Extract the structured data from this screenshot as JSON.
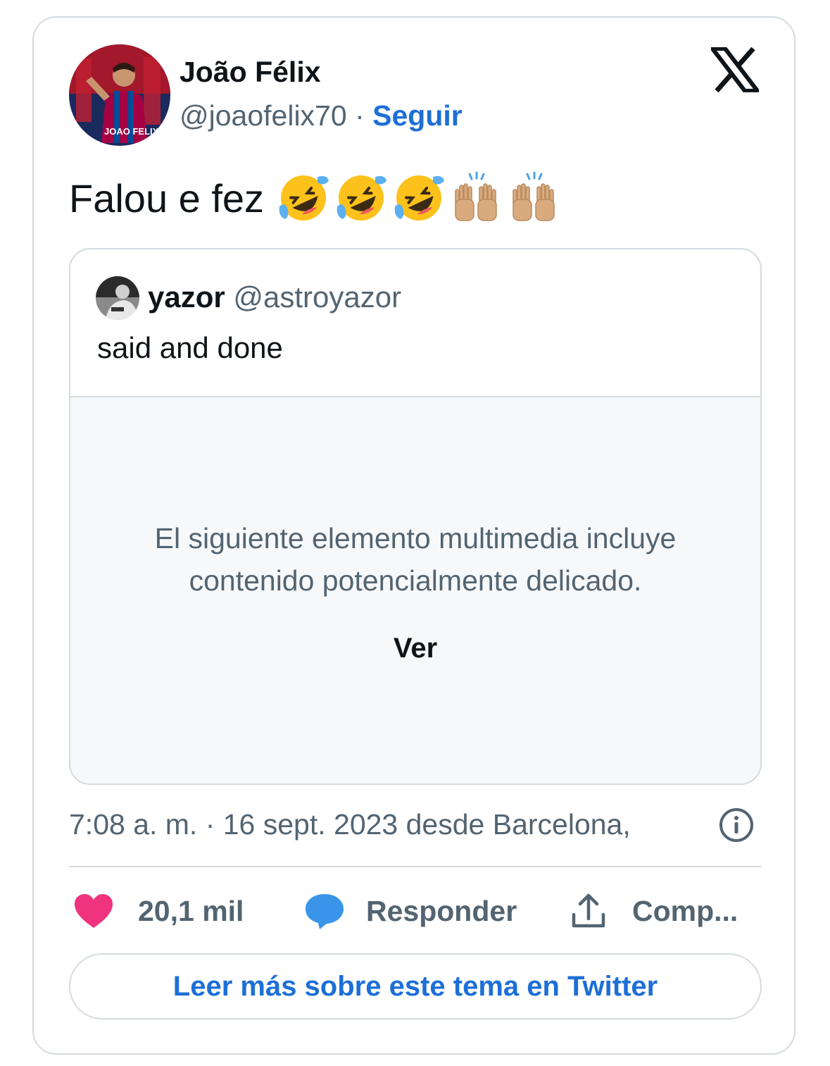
{
  "author": {
    "name": "João Félix",
    "handle": "@joaofelix70",
    "separator": "·",
    "follow_label": "Seguir"
  },
  "tweet": {
    "text": "Falou e fez",
    "emojis": [
      "rolling-on-floor-laughing",
      "rolling-on-floor-laughing",
      "rolling-on-floor-laughing",
      "raising-hands",
      "raising-hands"
    ]
  },
  "quote": {
    "name": "yazor",
    "handle": "@astroyazor",
    "text": "said and done",
    "media_warning_line1": "El siguiente elemento multimedia incluye",
    "media_warning_line2": "contenido potencialmente delicado.",
    "view_label": "Ver"
  },
  "timestamp": "7:08 a. m. · 16 sept. 2023 desde Barcelona,",
  "actions": {
    "likes": "20,1 mil",
    "reply_label": "Responder",
    "share_label": "Comp..."
  },
  "read_more_label": "Leer más sobre este tema en Twitter",
  "colors": {
    "link_blue": "#1d6fd6",
    "like_pink": "#f91880",
    "reply_blue": "#1d9bf0",
    "secondary_text": "#536471",
    "border": "#d5dbe0"
  }
}
